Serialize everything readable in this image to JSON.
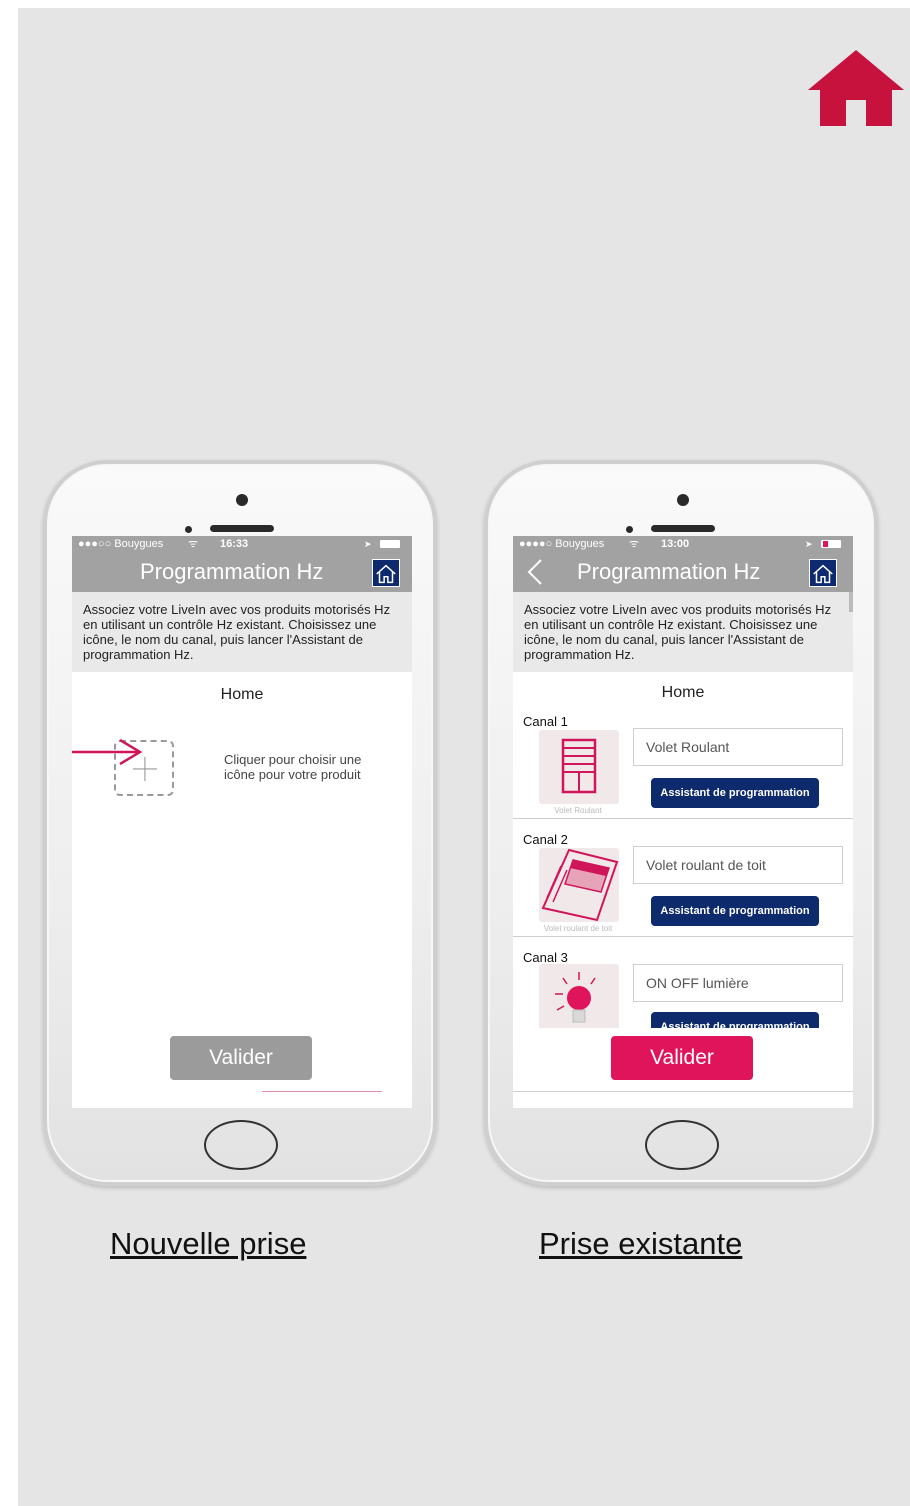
{
  "colors": {
    "accent_pink": "#e0145a",
    "home_red": "#c8123e",
    "navy": "#0d2a6c",
    "bar_gray": "#a2a2a2",
    "valider_gray": "#9b9b9b"
  },
  "top_home_icon": "home-icon",
  "phone_left": {
    "status": {
      "carrier": "●●●○○ Bouygues",
      "wifi": "ᯤ",
      "time": "16:33",
      "location": "➤"
    },
    "nav_title": "Programmation Hz",
    "description": "Associez votre LiveIn avec vos produits motorisés Hz en utilisant un contrôle Hz existant. Choisissez une icône, le nom du canal, puis lancer l'Assistant de programmation Hz.",
    "room": "Home",
    "add_hint": "Cliquer pour choisir une icône pour votre produit",
    "add_icon": "plus-icon",
    "arrow_icon": "arrow-right-icon",
    "valider": "Valider"
  },
  "phone_right": {
    "status": {
      "carrier": "●●●●○ Bouygues",
      "wifi": "ᯤ",
      "time": "13:00",
      "location": "➤"
    },
    "nav_title": "Programmation Hz",
    "description": "Associez votre LiveIn avec vos produits motorisés Hz en utilisant un contrôle Hz existant. Choisissez une icône, le nom du canal, puis lancer l'Assistant de programmation Hz.",
    "room": "Home",
    "canals": [
      {
        "label": "Canal 1",
        "name": "Volet Roulant",
        "caption": "Volet Roulant",
        "icon": "roller-shutter-icon",
        "button": "Assistant de programmation"
      },
      {
        "label": "Canal 2",
        "name": "Volet roulant de toit",
        "caption": "Volet roulant de toit",
        "icon": "roof-shutter-icon",
        "button": "Assistant de programmation"
      },
      {
        "label": "Canal 3",
        "name": "ON OFF lumière",
        "caption": "",
        "icon": "light-bulb-icon",
        "button": "Assistant de programmation"
      }
    ],
    "valider": "Valider"
  },
  "captions": {
    "left": "Nouvelle prise",
    "right": "Prise existante"
  }
}
